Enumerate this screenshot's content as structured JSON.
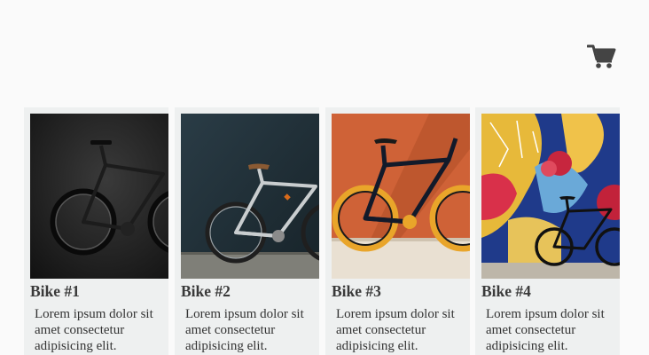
{
  "header": {
    "cart_icon": "shopping-cart-icon"
  },
  "products": [
    {
      "title": "Bike #1",
      "description": "Lorem ipsum dolor sit amet consectetur adipisicing elit."
    },
    {
      "title": "Bike #2",
      "description": "Lorem ipsum dolor sit amet consectetur adipisicing elit."
    },
    {
      "title": "Bike #3",
      "description": "Lorem ipsum dolor sit amet consectetur adipisicing elit."
    },
    {
      "title": "Bike #4",
      "description": "Lorem ipsum dolor sit amet consectetur adipisicing elit."
    }
  ]
}
